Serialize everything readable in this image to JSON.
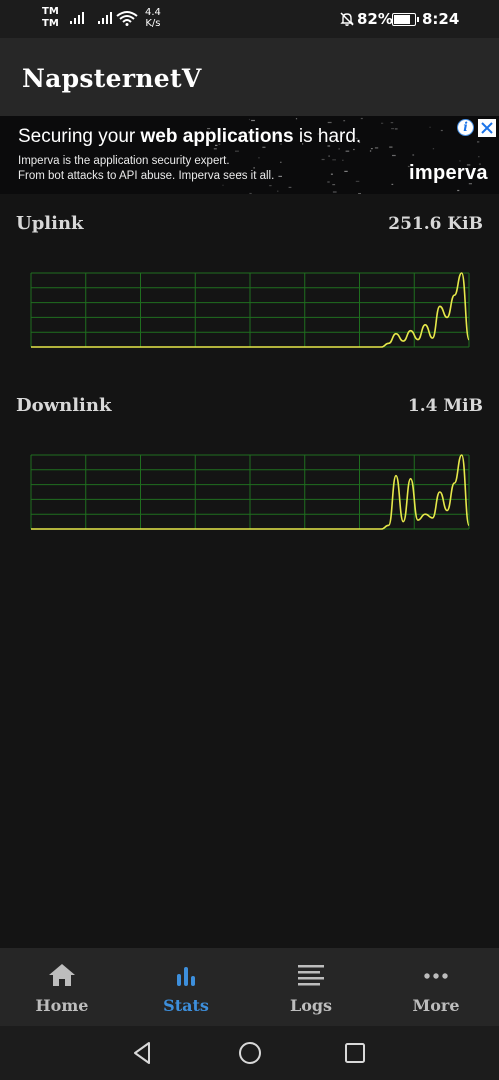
{
  "status_bar": {
    "carrier_top": "TM",
    "carrier_bottom": "TM",
    "net_speed_value": "4.4",
    "net_speed_unit": "K/s",
    "battery_percent": "82%",
    "battery_level": 0.82,
    "time": "8:24"
  },
  "app_bar": {
    "title": "NapsternetV"
  },
  "ad": {
    "headline_prefix": "Securing your ",
    "headline_bold": "web applications",
    "headline_suffix": " is hard.",
    "body_line1": "Imperva is the application security expert.",
    "body_line2": "From bot attacks to API abuse. Imperva sees it all.",
    "brand": "imperva",
    "info_glyph": "i"
  },
  "stats": {
    "uplink": {
      "label": "Uplink",
      "value": "251.6 KiB"
    },
    "downlink": {
      "label": "Downlink",
      "value": "1.4 MiB"
    }
  },
  "chart_data": [
    {
      "type": "line",
      "name": "uplink-traffic",
      "grid": true,
      "colors": {
        "line": "#e6e84a",
        "grid": "#1f6e1f",
        "background": "#141414"
      },
      "x": [
        0,
        1,
        2,
        3,
        4,
        5,
        6,
        7,
        8,
        9,
        10,
        11,
        12,
        13,
        14,
        15,
        16,
        17,
        18,
        19,
        20,
        21,
        22,
        23,
        24,
        25,
        26,
        27,
        28,
        29,
        30,
        31,
        32,
        33,
        34,
        35,
        36,
        37,
        38,
        39,
        40,
        41,
        42,
        43,
        44,
        45,
        46,
        47,
        48,
        49,
        50,
        51,
        52,
        53,
        54,
        55,
        56,
        57,
        58,
        59,
        60
      ],
      "values": [
        0,
        0,
        0,
        0,
        0,
        0,
        0,
        0,
        0,
        0,
        0,
        0,
        0,
        0,
        0,
        0,
        0,
        0,
        0,
        0,
        0,
        0,
        0,
        0,
        0,
        0,
        0,
        0,
        0,
        0,
        0,
        0,
        0,
        0,
        0,
        0,
        0,
        0,
        0,
        0,
        0,
        0,
        0,
        0,
        0,
        0,
        0,
        0,
        0,
        0.05,
        0.18,
        0.08,
        0.22,
        0.1,
        0.3,
        0.12,
        0.55,
        0.4,
        0.7,
        1.0,
        0.1
      ],
      "ylim": [
        0,
        1
      ]
    },
    {
      "type": "line",
      "name": "downlink-traffic",
      "grid": true,
      "colors": {
        "line": "#e6e84a",
        "grid": "#1f6e1f",
        "background": "#141414"
      },
      "x": [
        0,
        1,
        2,
        3,
        4,
        5,
        6,
        7,
        8,
        9,
        10,
        11,
        12,
        13,
        14,
        15,
        16,
        17,
        18,
        19,
        20,
        21,
        22,
        23,
        24,
        25,
        26,
        27,
        28,
        29,
        30,
        31,
        32,
        33,
        34,
        35,
        36,
        37,
        38,
        39,
        40,
        41,
        42,
        43,
        44,
        45,
        46,
        47,
        48,
        49,
        50,
        51,
        52,
        53,
        54,
        55,
        56,
        57,
        58,
        59,
        60
      ],
      "values": [
        0,
        0,
        0,
        0,
        0,
        0,
        0,
        0,
        0,
        0,
        0,
        0,
        0,
        0,
        0,
        0,
        0,
        0,
        0,
        0,
        0,
        0,
        0,
        0,
        0,
        0,
        0,
        0,
        0,
        0,
        0,
        0,
        0,
        0,
        0,
        0,
        0,
        0,
        0,
        0,
        0,
        0,
        0,
        0,
        0,
        0,
        0,
        0,
        0,
        0.05,
        0.72,
        0.1,
        0.68,
        0.12,
        0.2,
        0.15,
        0.5,
        0.25,
        0.62,
        1.0,
        0.05
      ],
      "ylim": [
        0,
        1
      ]
    }
  ],
  "bottom_nav": {
    "items": [
      {
        "label": "Home",
        "icon": "home-icon",
        "active": false
      },
      {
        "label": "Stats",
        "icon": "bar-chart-icon",
        "active": true
      },
      {
        "label": "Logs",
        "icon": "lines-icon",
        "active": false
      },
      {
        "label": "More",
        "icon": "more-horizontal-icon",
        "active": false
      }
    ],
    "active_color": "#3d8fdc",
    "inactive_color": "#bdbdbd"
  },
  "system_nav": {
    "back": "back-icon",
    "home": "home-circle-icon",
    "recents": "recents-icon"
  }
}
